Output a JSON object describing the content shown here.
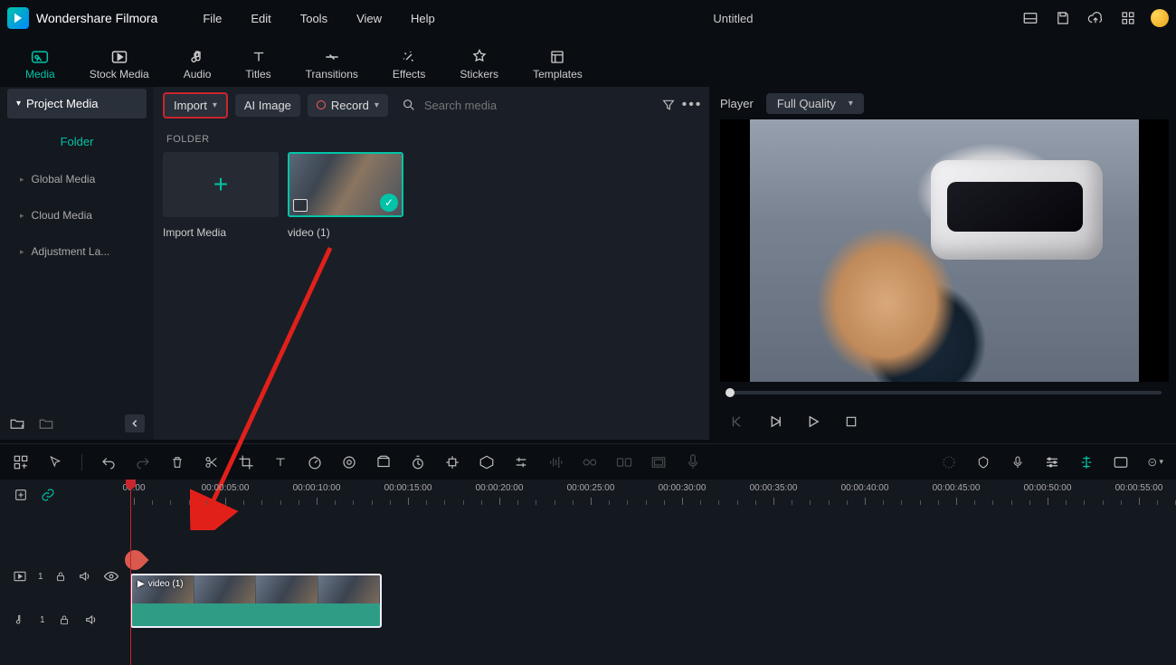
{
  "app": {
    "name": "Wondershare Filmora",
    "title": "Untitled"
  },
  "menu": [
    "File",
    "Edit",
    "Tools",
    "View",
    "Help"
  ],
  "tabs": [
    {
      "name": "media",
      "label": "Media",
      "active": true
    },
    {
      "name": "stock-media",
      "label": "Stock Media"
    },
    {
      "name": "audio",
      "label": "Audio"
    },
    {
      "name": "titles",
      "label": "Titles"
    },
    {
      "name": "transitions",
      "label": "Transitions"
    },
    {
      "name": "effects",
      "label": "Effects"
    },
    {
      "name": "stickers",
      "label": "Stickers"
    },
    {
      "name": "templates",
      "label": "Templates"
    }
  ],
  "sidebar": {
    "header": "Project Media",
    "folder": "Folder",
    "items": [
      "Global Media",
      "Cloud Media",
      "Adjustment La..."
    ]
  },
  "toolbar": {
    "import": "Import",
    "ai_image": "AI Image",
    "record": "Record",
    "search_placeholder": "Search media"
  },
  "media": {
    "section": "FOLDER",
    "import_label": "Import Media",
    "video_label": "video (1)"
  },
  "preview": {
    "player": "Player",
    "quality": "Full Quality"
  },
  "ruler": {
    "labels": [
      "00:00",
      "00:00:05:00",
      "00:00:10:00",
      "00:00:15:00",
      "00:00:20:00",
      "00:00:25:00",
      "00:00:30:00",
      "00:00:35:00",
      "00:00:40:00",
      "00:00:45:00",
      "00:00:50:00",
      "00:00:55:00"
    ]
  },
  "clip": {
    "name": "video (1)"
  },
  "colors": {
    "accent": "#00c4a7",
    "highlight": "#c9252d"
  }
}
